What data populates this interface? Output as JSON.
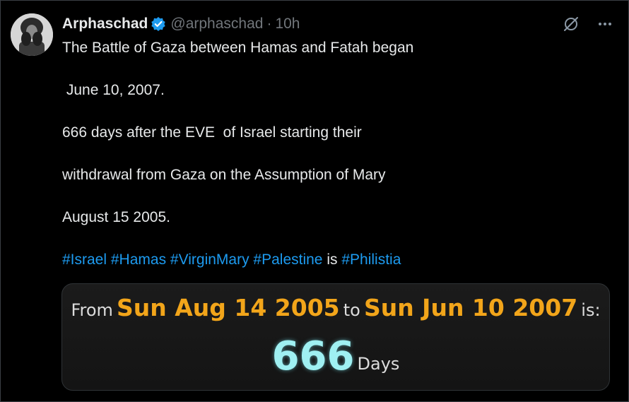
{
  "tweet": {
    "author_name": "Arphaschad",
    "handle": "@arphaschad",
    "separator": "·",
    "time": "10h",
    "lines": [
      "The Battle of Gaza between Hamas and Fatah began",
      " June 10, 2007.",
      "666 days after the EVE  of Israel starting their",
      "withdrawal from Gaza on the Assumption of Mary",
      "August 15 2005."
    ],
    "hashtags": {
      "h1": "#Israel",
      "h2": "#Hamas",
      "h3": "#VirginMary",
      "h4": "#Palestine",
      "connector": "is",
      "h5": "#Philistia"
    }
  },
  "card": {
    "from_label": "From",
    "from_date": "Sun Aug 14 2005",
    "to_label": "to",
    "to_date": "Sun Jun 10 2007",
    "is_label": "is:",
    "count": "666",
    "unit": "Days"
  },
  "icons": [
    "verified-badge-icon",
    "grok-icon",
    "more-icon"
  ],
  "colors": {
    "background": "#000000",
    "text": "#e7e9ea",
    "muted": "#71767b",
    "link": "#1d9bf0",
    "verified": "#1d9bf0",
    "date_orange": "#f2a51a",
    "count_cyan": "#9ff0f2"
  }
}
